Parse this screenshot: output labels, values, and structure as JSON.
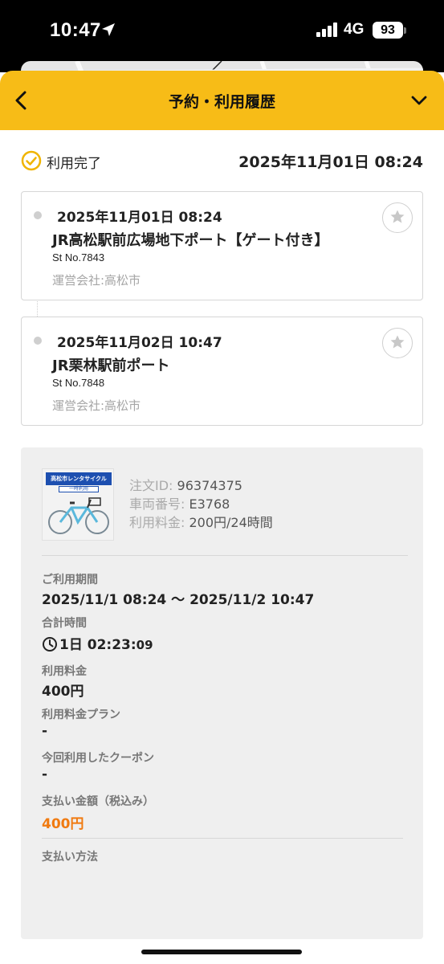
{
  "status_bar": {
    "time": "10:47",
    "network": "4G",
    "battery": "93"
  },
  "header": {
    "title": "予約・利用履歴"
  },
  "status": {
    "label": "利用完了",
    "datetime": "2025年11月01日 08:24"
  },
  "stations": [
    {
      "datetime": "2025年11月01日 08:24",
      "name": "JR高松駅前広場地下ポート【ゲート付き】",
      "st_no": "St No.7843",
      "operator": "運営会社:高松市"
    },
    {
      "datetime": "2025年11月02日 10:47",
      "name": "JR栗林駅前ポート",
      "st_no": "St No.7848",
      "operator": "運営会社:高松市"
    }
  ],
  "bike": {
    "banner": "高松市レンタサイクル",
    "banner_sub": "一時利用",
    "order_id_label": "注文ID:",
    "order_id": "96374375",
    "vehicle_label": "車両番号:",
    "vehicle": "E3768",
    "fee_label": "利用料金:",
    "fee": "200円/24時間"
  },
  "details": {
    "period_label": "ご利用期間",
    "period": "2025/11/1 08:24 〜 2025/11/2 10:47",
    "total_time_label": "合計時間",
    "total_time": "1日 02:23:",
    "total_time_seconds": "09",
    "usage_fee_label": "利用料金",
    "usage_fee": "400円",
    "plan_label": "利用料金プラン",
    "plan": "-",
    "coupon_label": "今回利用したクーポン",
    "coupon": "-",
    "payment_amount_label": "支払い金額（税込み）",
    "payment_amount": "400円",
    "payment_method_label": "支払い方法"
  },
  "colors": {
    "header": "#f7bc17",
    "accent_orange": "#f07a10",
    "check": "#f0b400"
  }
}
